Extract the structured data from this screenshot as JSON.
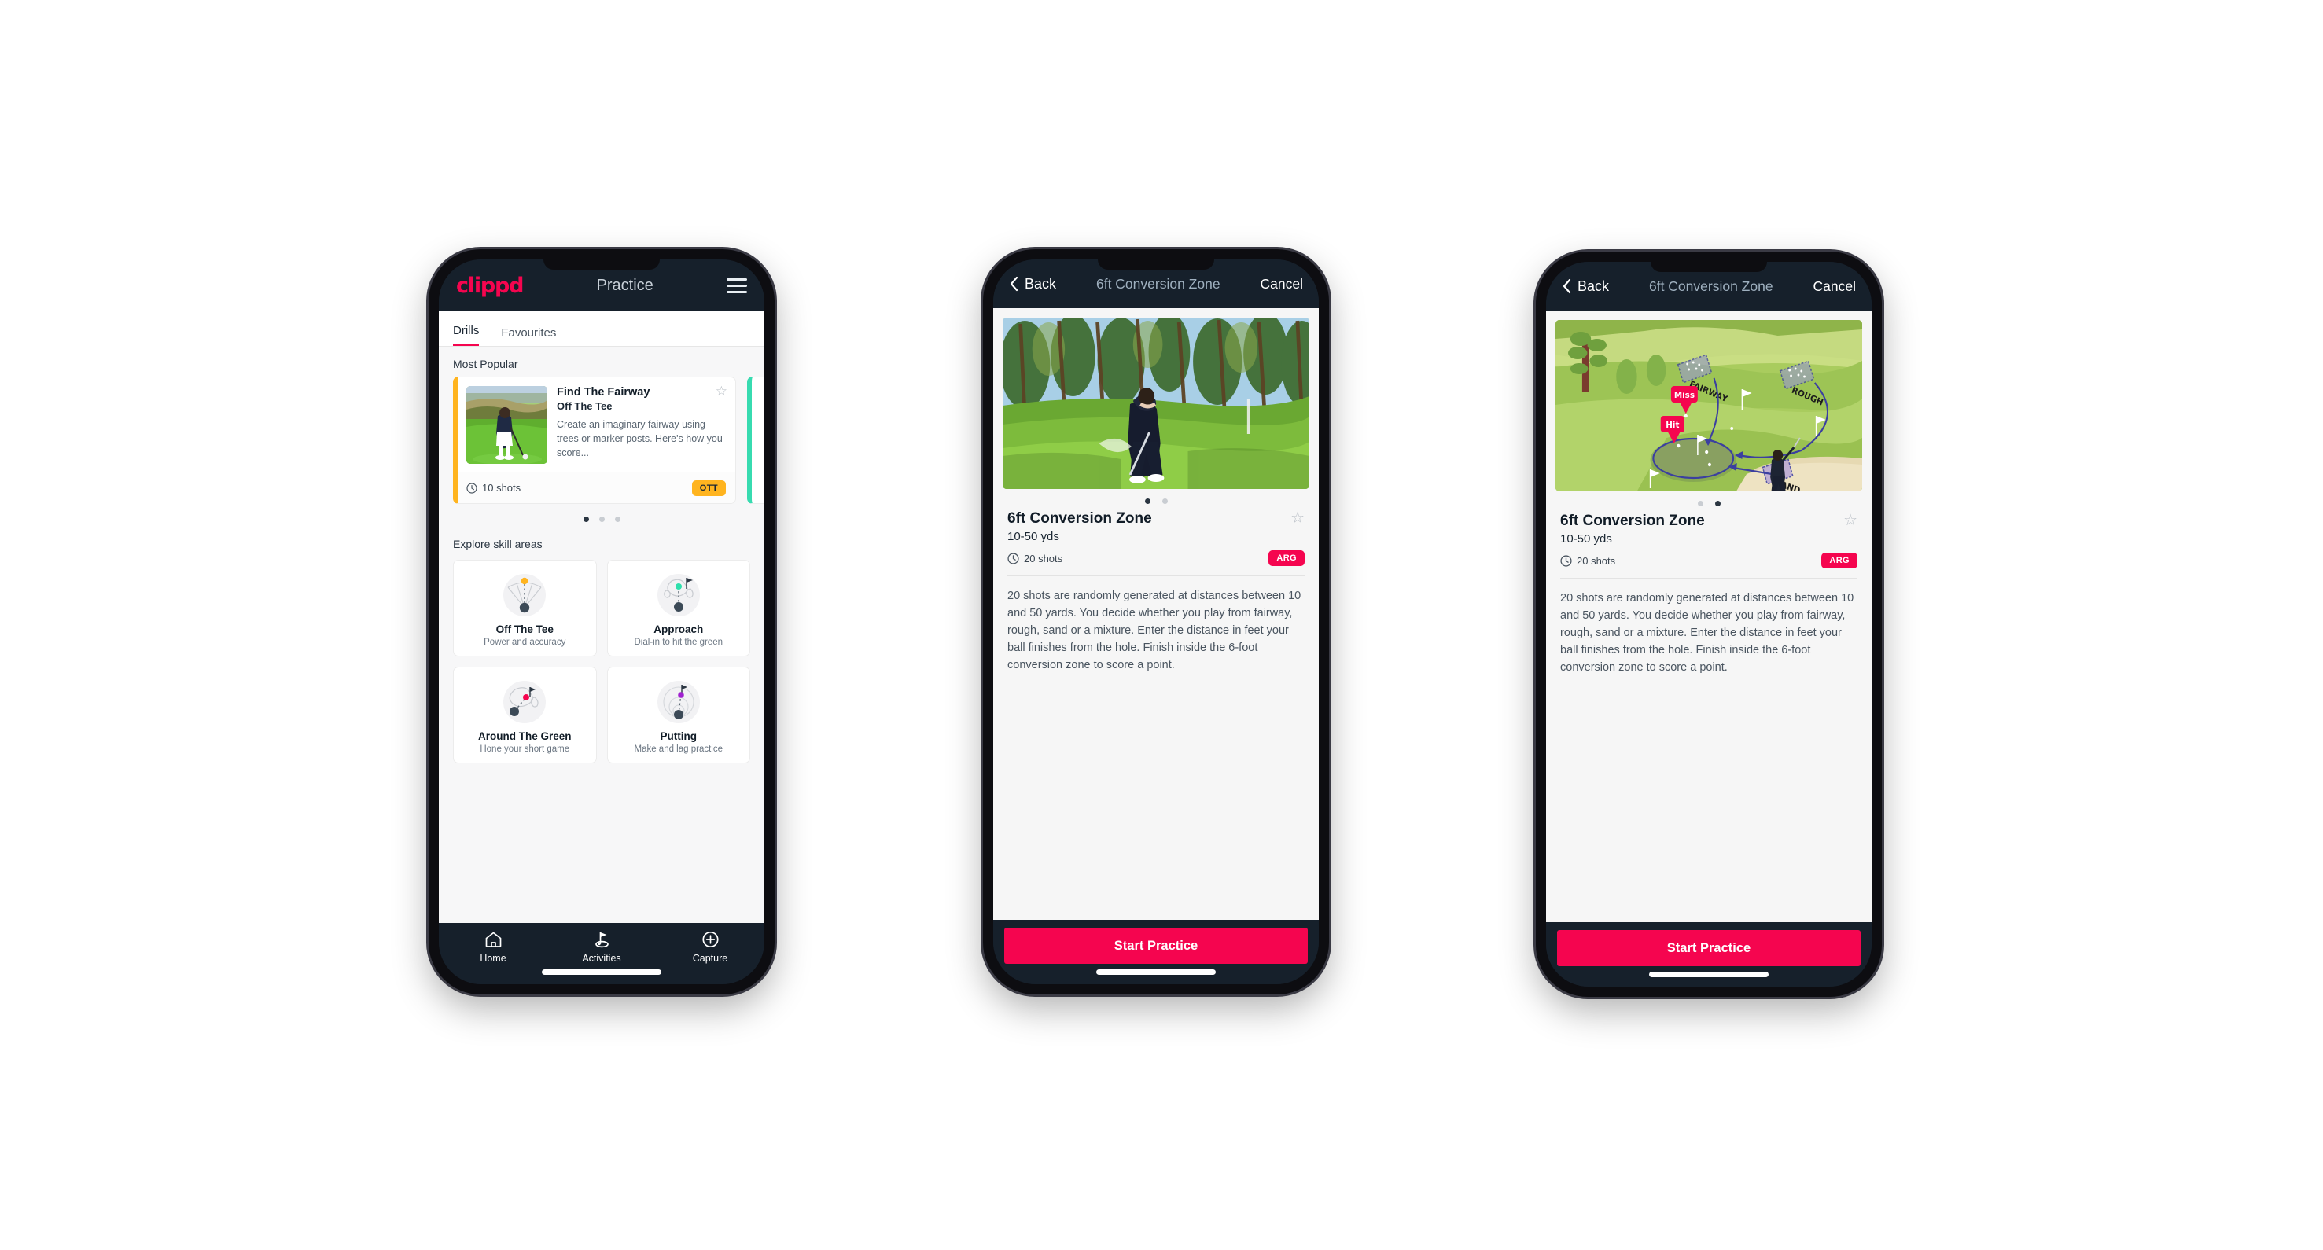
{
  "brand": {
    "logo_text": "clippd",
    "accent": "#f5054f",
    "dark": "#16202b"
  },
  "phone1": {
    "appbar": {
      "title": "Practice",
      "menu_icon": "hamburger-menu-icon"
    },
    "tabs": [
      {
        "label": "Drills",
        "active": true
      },
      {
        "label": "Favourites",
        "active": false
      }
    ],
    "most_popular": {
      "section_title": "Most Popular",
      "card": {
        "name": "Find The Fairway",
        "subtitle": "Off The Tee",
        "description": "Create an imaginary fairway using trees or marker posts. Here's how you score...",
        "shots": "10 shots",
        "badge": "OTT",
        "badge_color": "#FFB41F",
        "accent_color": "#FFB41F",
        "star_icon": "star-outline-icon",
        "shots_icon": "clock-icon"
      },
      "next_card_accent": "#37dbb0",
      "dots": [
        true,
        false,
        false
      ]
    },
    "skill_areas": {
      "section_title": "Explore skill areas",
      "cards": [
        {
          "name": "Off The Tee",
          "desc": "Power and accuracy",
          "icon": "off-the-tee-icon",
          "dot_color": "#FFB41F"
        },
        {
          "name": "Approach",
          "desc": "Dial-in to hit the green",
          "icon": "approach-icon",
          "dot_color": "#2ee0ac"
        },
        {
          "name": "Around The Green",
          "desc": "Hone your short game",
          "icon": "around-the-green-icon",
          "dot_color": "#f5054f"
        },
        {
          "name": "Putting",
          "desc": "Make and lag practice",
          "icon": "putting-icon",
          "dot_color": "#a020d0"
        }
      ]
    },
    "bottom_nav": [
      {
        "label": "Home",
        "icon": "home-icon",
        "active": false
      },
      {
        "label": "Activities",
        "icon": "golf-flag-icon",
        "active": true
      },
      {
        "label": "Capture",
        "icon": "plus-circle-icon",
        "active": false
      }
    ]
  },
  "detail": {
    "appbar": {
      "back": "Back",
      "title": "6ft Conversion Zone",
      "cancel": "Cancel",
      "back_icon": "chevron-left-icon"
    },
    "name": "6ft Conversion Zone",
    "range": "10-50 yds",
    "shots": "20 shots",
    "badge": "ARG",
    "badge_color": "#f5054f",
    "star_icon": "star-outline-icon",
    "shots_icon": "clock-icon",
    "description": "20 shots are randomly generated at distances between 10 and 50 yards. You decide whether you play from fairway, rough, sand or a mixture. Enter the distance in feet your ball finishes from the hole. Finish inside the 6-foot conversion zone to score a point.",
    "cta": "Start Practice"
  },
  "phone2": {
    "dots": [
      true,
      false
    ],
    "media": "golf-chipping-photo"
  },
  "phone3": {
    "dots": [
      false,
      true
    ],
    "media": "course-diagram-illustration",
    "diagram_labels": {
      "fairway": "FAIRWAY",
      "rough": "ROUGH",
      "sand": "SAND",
      "hit": "Hit",
      "miss": "Miss"
    }
  }
}
